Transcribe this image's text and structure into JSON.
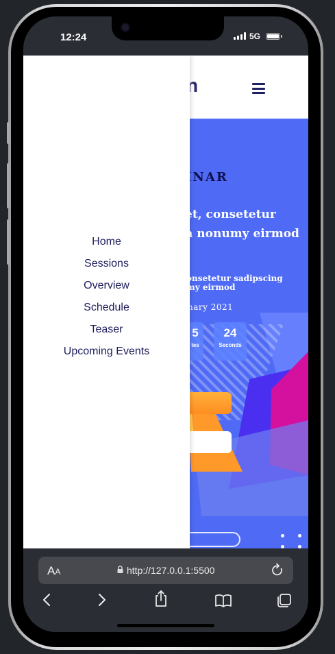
{
  "status_bar": {
    "time": "12:24",
    "network": "5G"
  },
  "site": {
    "logo_fragment": "n",
    "hero": {
      "title_fragment": "INAR",
      "heading_line1": "et, consetetur",
      "heading_line2": "n nonumy eirmod",
      "sub_line1": "onsetetur sadipscing",
      "sub_line2": "my eirmod",
      "date_fragment": "nary 2021",
      "countdown": [
        {
          "value": "5",
          "label": "tes"
        },
        {
          "value": "24",
          "label": "Seconds"
        }
      ]
    }
  },
  "drawer": {
    "menu": [
      "Home",
      "Sessions",
      "Overview",
      "Schedule",
      "Teaser",
      "Upcoming Events"
    ]
  },
  "browser": {
    "text_size_label": "AA",
    "url": "http://127.0.0.1:5500"
  },
  "colors": {
    "hero_blue": "#4f6bf5",
    "nav_text": "#1d1d5c",
    "accent_orange": "#ff9a2a",
    "accent_magenta": "#d4109e"
  }
}
